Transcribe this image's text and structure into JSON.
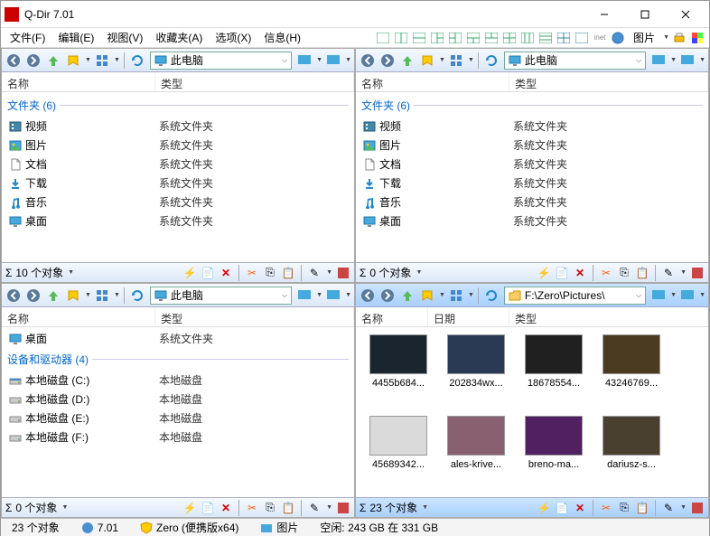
{
  "window": {
    "title": "Q-Dir 7.01",
    "version": "7.01"
  },
  "menu": {
    "file": "文件(F)",
    "edit": "编辑(E)",
    "view": "视图(V)",
    "favorites": "收藏夹(A)",
    "options": "选项(X)",
    "info": "信息(H)",
    "images": "图片"
  },
  "columns": {
    "name": "名称",
    "type": "类型",
    "date": "日期"
  },
  "locations": {
    "this_pc": "此电脑",
    "pictures_path": "F:\\Zero\\Pictures\\"
  },
  "groups": {
    "folders": "文件夹 (6)",
    "devices": "设备和驱动器 (4)"
  },
  "sysfolders": [
    {
      "name": "视频",
      "type": "系统文件夹",
      "icon": "video"
    },
    {
      "name": "图片",
      "type": "系统文件夹",
      "icon": "pictures"
    },
    {
      "name": "文档",
      "type": "系统文件夹",
      "icon": "documents"
    },
    {
      "name": "下载",
      "type": "系统文件夹",
      "icon": "downloads"
    },
    {
      "name": "音乐",
      "type": "系统文件夹",
      "icon": "music"
    },
    {
      "name": "桌面",
      "type": "系统文件夹",
      "icon": "desktop"
    }
  ],
  "pane3": {
    "desktop": {
      "name": "桌面",
      "type": "系统文件夹"
    },
    "drives": [
      {
        "name": "本地磁盘 (C:)",
        "type": "本地磁盘",
        "icon": "drive-c"
      },
      {
        "name": "本地磁盘 (D:)",
        "type": "本地磁盘",
        "icon": "drive"
      },
      {
        "name": "本地磁盘 (E:)",
        "type": "本地磁盘",
        "icon": "drive"
      },
      {
        "name": "本地磁盘 (F:)",
        "type": "本地磁盘",
        "icon": "drive"
      }
    ]
  },
  "thumbs": [
    "4455b684...",
    "202834wx...",
    "18678554...",
    "43246769...",
    "45689342...",
    "ales-krive...",
    "breno-ma...",
    "dariusz-s..."
  ],
  "thumb_colors": [
    "#1a2530",
    "#2a3a55",
    "#202020",
    "#4a3a20",
    "#dadada",
    "#886070",
    "#502060",
    "#4a4030"
  ],
  "pane_status": {
    "p1": "10 个对象",
    "p2": "0 个对象",
    "p3": "0 个对象",
    "p4": "23 个对象"
  },
  "statusbar": {
    "objects": "23 个对象",
    "zero_mode": "Zero (便携版x64)",
    "current": "图片",
    "space": "空闲: 243 GB 在 331 GB"
  },
  "sigma": "Σ"
}
